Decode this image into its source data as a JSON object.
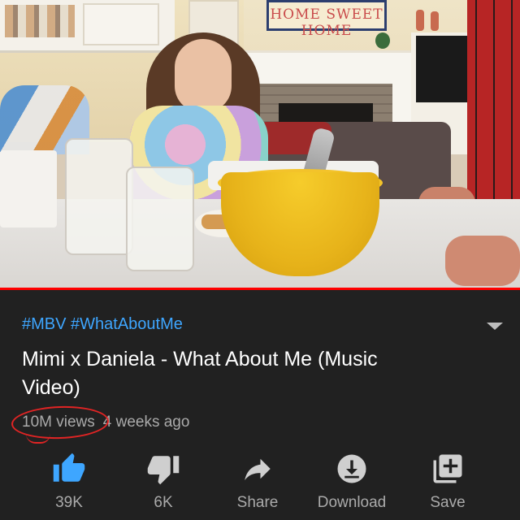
{
  "video": {
    "sign_text": "HOME SWEET HOME",
    "progress": 1.0,
    "progress_color": "#ff0000"
  },
  "description": {
    "hashtags": "#MBV #WhatAboutMe",
    "title": "Mimi x Daniela - What About Me (Music Video)",
    "views": "10M views",
    "age": "4 weeks ago"
  },
  "actions": [
    {
      "icon": "thumbs-up-icon",
      "label": "39K",
      "active": true
    },
    {
      "icon": "thumbs-down-icon",
      "label": "6K",
      "active": false
    },
    {
      "icon": "share-icon",
      "label": "Share",
      "active": false
    },
    {
      "icon": "download-icon",
      "label": "Download",
      "active": false
    },
    {
      "icon": "add-to-playlist-icon",
      "label": "Save",
      "active": false
    }
  ],
  "colors": {
    "background": "#212121",
    "hashtag": "#3ea6ff",
    "like_active": "#3ea6ff",
    "icon": "#cfcfcf",
    "annotation": "#e02424"
  }
}
